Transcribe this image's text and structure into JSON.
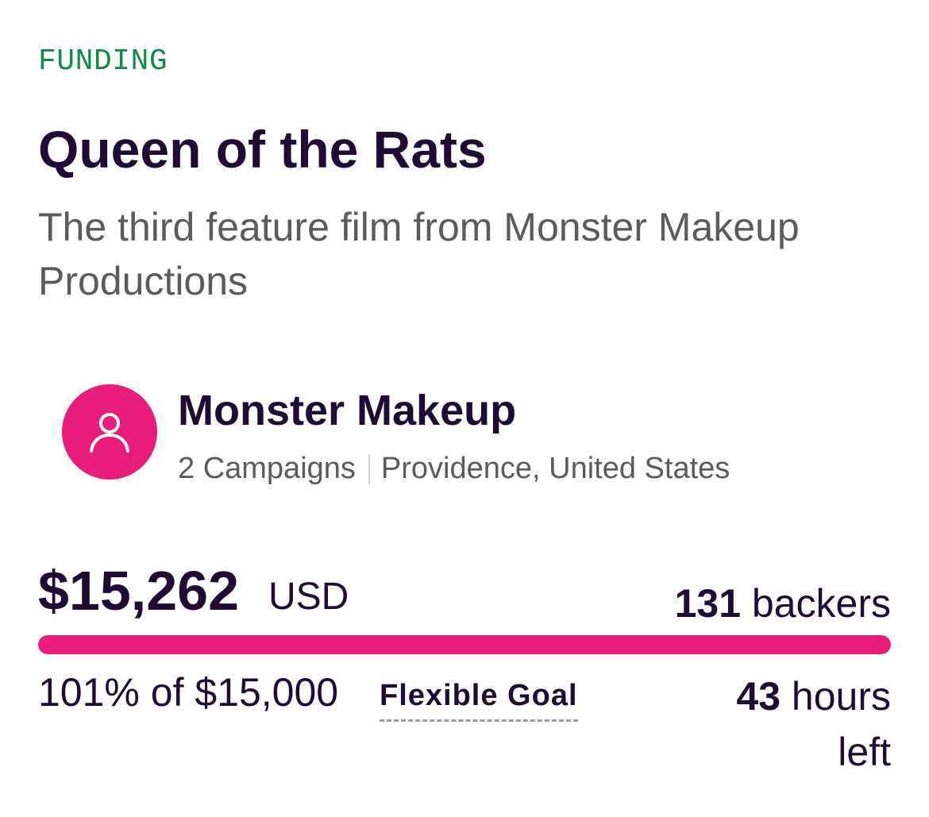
{
  "campaign": {
    "status": "FUNDING",
    "title": "Queen of the Rats",
    "subtitle": "The third feature film from Monster Makeup Productions"
  },
  "creator": {
    "avatar_icon": "user-icon",
    "avatar_color": "#e81c7a",
    "name": "Monster Makeup",
    "campaigns": "2 Campaigns",
    "location": "Providence, United States"
  },
  "funding": {
    "amount": "$15,262",
    "currency": "USD",
    "backers_count": "131",
    "backers_label": "backers",
    "progress_fraction": 1.0,
    "funded_text": "101% of $15,000",
    "goal_type": "Flexible Goal",
    "time_value": "43",
    "time_unit": "hours left"
  },
  "colors": {
    "accent": "#e81c7a",
    "status": "#138a4a",
    "text_primary": "#1f0b33",
    "text_secondary": "#5a5a5f"
  }
}
